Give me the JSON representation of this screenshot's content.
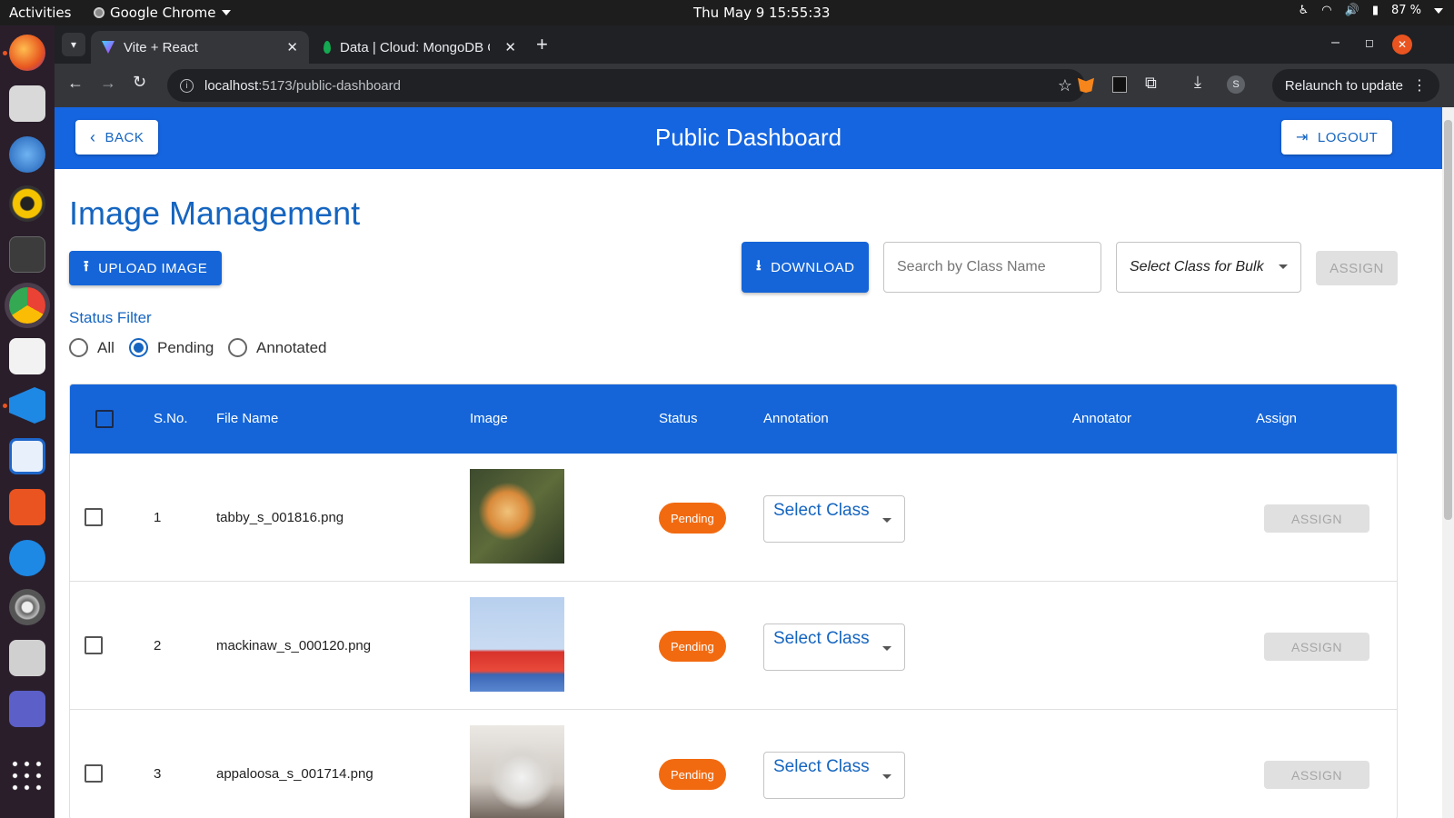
{
  "system": {
    "activities": "Activities",
    "app_name": "Google Chrome",
    "clock": "Thu May 9  15:55:33",
    "battery": "87 %"
  },
  "browser": {
    "tabs": [
      {
        "label": "Vite + React",
        "active": true
      },
      {
        "label": "Data | Cloud: MongoDB C",
        "active": false
      }
    ],
    "url_host": "localhost",
    "url_path": ":5173/public-dashboard",
    "relaunch_label": "Relaunch to update",
    "profile_initial": "S"
  },
  "header": {
    "title": "Public Dashboard",
    "back_label": "BACK",
    "logout_label": "LOGOUT"
  },
  "page": {
    "title": "Image Management",
    "upload_label": "UPLOAD IMAGE",
    "download_label": "DOWNLOAD",
    "search_placeholder": "Search by Class Name",
    "bulk_select_placeholder": "Select Class for Bulk",
    "bulk_assign_label": "ASSIGN"
  },
  "status_filter": {
    "label": "Status Filter",
    "options": [
      "All",
      "Pending",
      "Annotated"
    ],
    "selected": "Pending"
  },
  "table": {
    "columns": [
      "S.No.",
      "File Name",
      "Image",
      "Status",
      "Annotation",
      "Annotator",
      "Assign"
    ],
    "rows": [
      {
        "sno": "1",
        "file_name": "tabby_s_001816.png",
        "status": "Pending",
        "annotation": "Select Class",
        "annotator": "",
        "assign": "ASSIGN"
      },
      {
        "sno": "2",
        "file_name": "mackinaw_s_000120.png",
        "status": "Pending",
        "annotation": "Select Class",
        "annotator": "",
        "assign": "ASSIGN"
      },
      {
        "sno": "3",
        "file_name": "appaloosa_s_001714.png",
        "status": "Pending",
        "annotation": "Select Class",
        "annotator": "",
        "assign": "ASSIGN"
      }
    ]
  },
  "colors": {
    "primary": "#1565d8",
    "pending_badge": "#f26a10"
  }
}
